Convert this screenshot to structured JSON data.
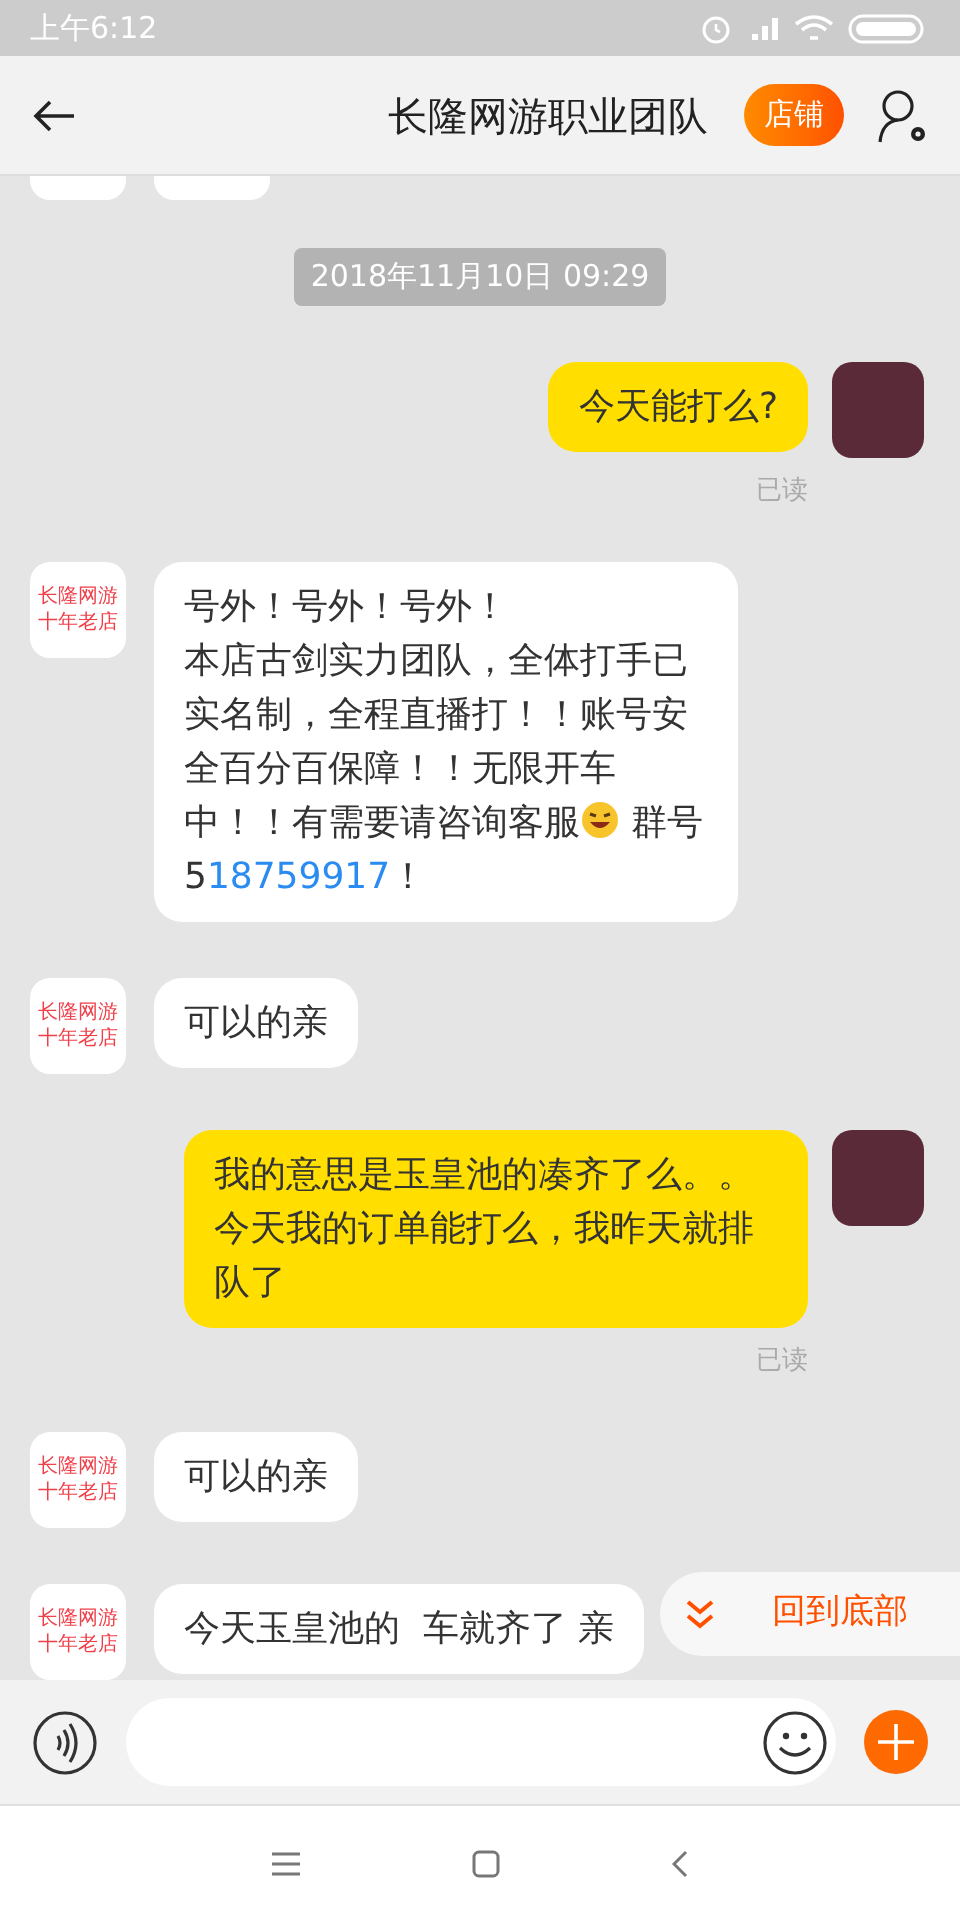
{
  "status_bar": {
    "time": "上午6:12"
  },
  "header": {
    "title": "长隆网游职业团队",
    "shop_button": "店铺"
  },
  "messages": [
    {
      "kind": "time",
      "text": "2018年11月10日 09:29"
    },
    {
      "kind": "sent",
      "paragraphs": [
        [
          {
            "text": "今天能打么?"
          }
        ]
      ],
      "receipt": "已读"
    },
    {
      "kind": "received",
      "avatar": [
        "长隆网游",
        "十年老店"
      ],
      "paragraphs": [
        [
          {
            "text": "号外！号外！号外！"
          }
        ],
        [
          {
            "text": "本店古剑实力团队，全体打手已实名制，全程直播打！！账号安全百分百保障！！无限开车中！！有需要请咨询客服"
          },
          {
            "emoji": true
          },
          {
            "text": " 群号5"
          },
          {
            "link": "18759917"
          },
          {
            "text": "！"
          }
        ]
      ]
    },
    {
      "kind": "received",
      "avatar": [
        "长隆网游",
        "十年老店"
      ],
      "paragraphs": [
        [
          {
            "text": "可以的亲"
          }
        ]
      ]
    },
    {
      "kind": "sent",
      "paragraphs": [
        [
          {
            "text": "我的意思是玉皇池的凑齐了么。。今天我的订单能打么，我昨天就排队了"
          }
        ]
      ],
      "receipt": "已读"
    },
    {
      "kind": "received",
      "avatar": [
        "长隆网游",
        "十年老店"
      ],
      "paragraphs": [
        [
          {
            "text": "可以的亲"
          }
        ]
      ]
    },
    {
      "kind": "received",
      "avatar": [
        "长隆网游",
        "十年老店"
      ],
      "paragraphs": [
        [
          {
            "text": "今天玉皇池的  车就齐了 亲"
          }
        ]
      ]
    }
  ],
  "scroll_bottom_button": "回到底部"
}
